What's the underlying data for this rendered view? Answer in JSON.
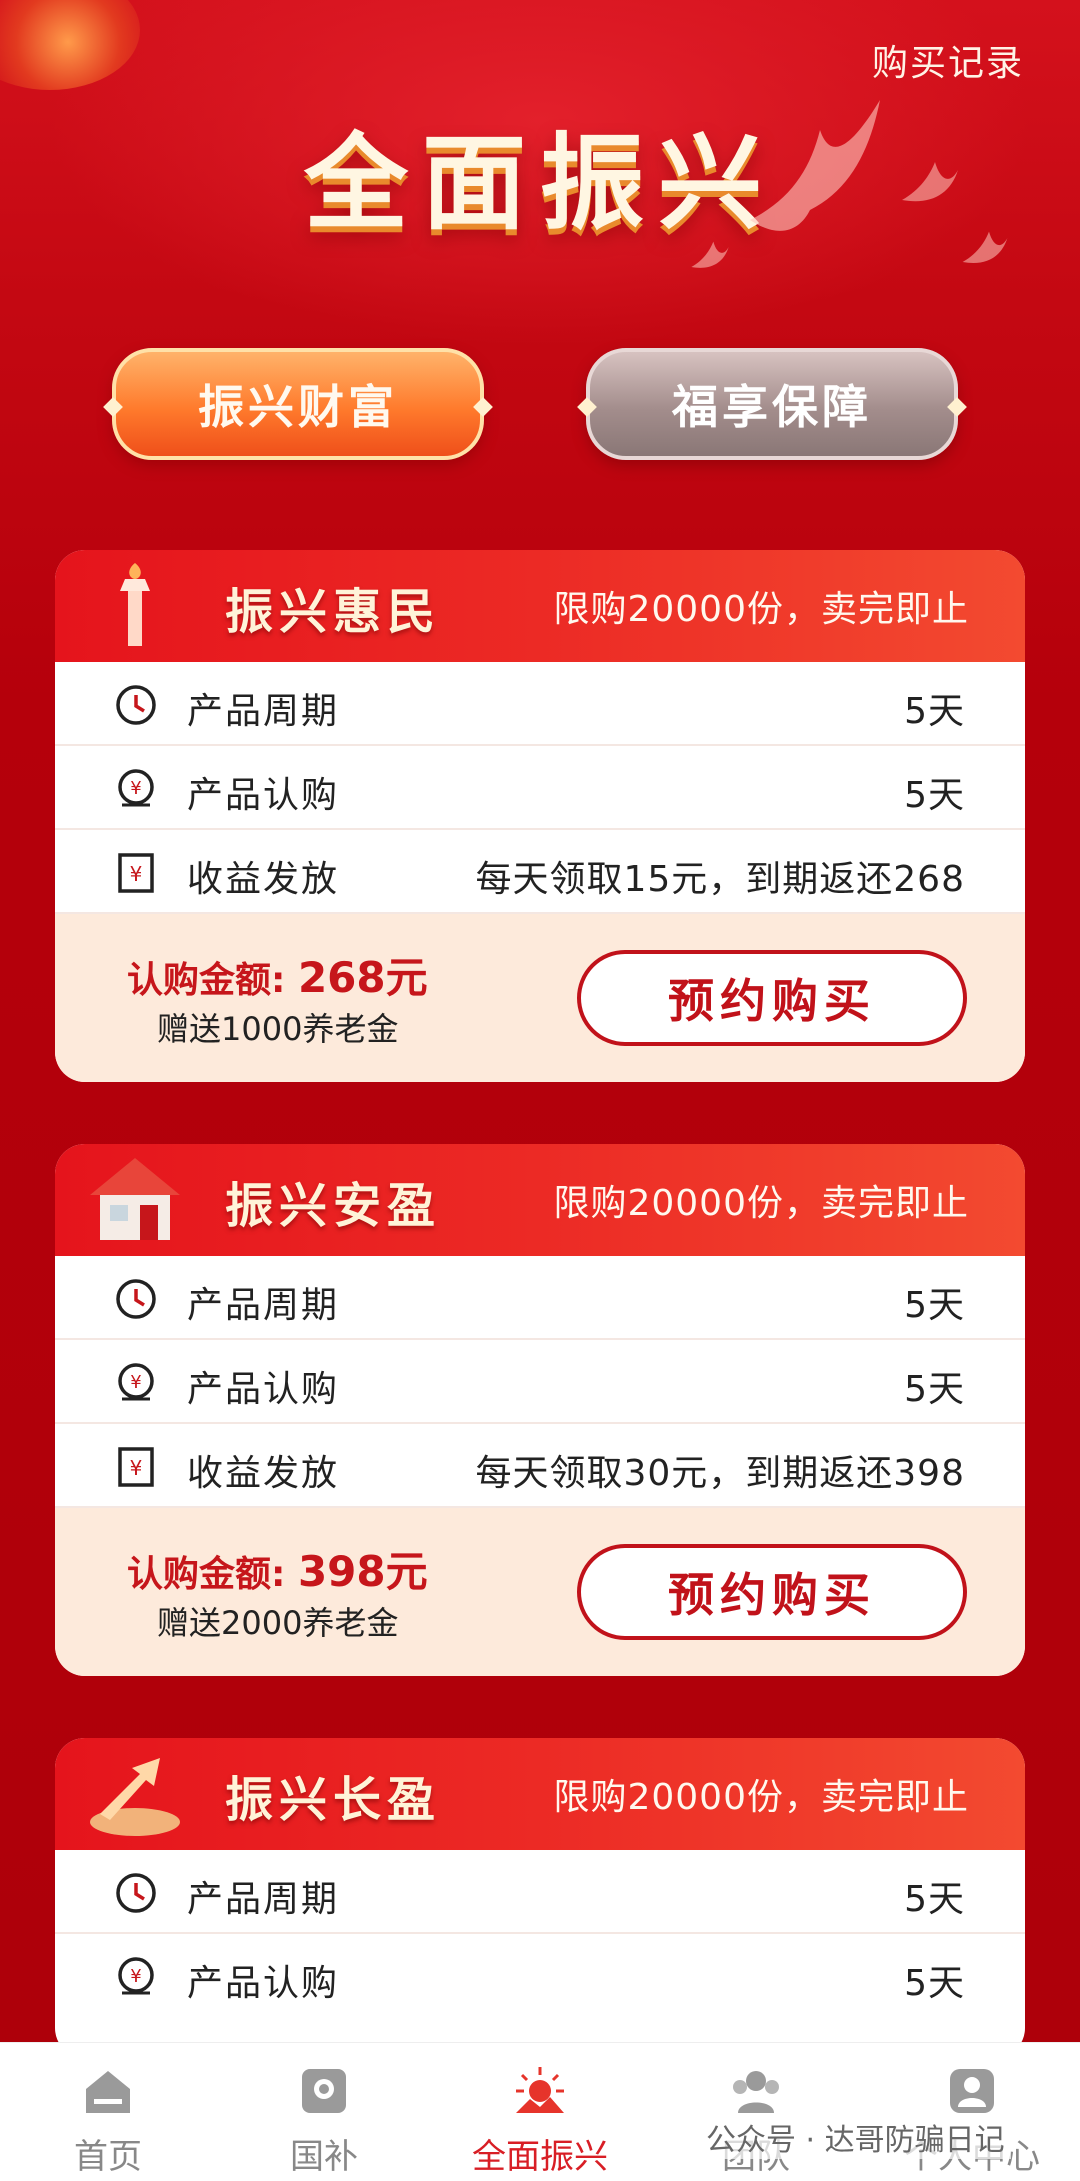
{
  "header": {
    "title": "全面振兴",
    "record_link": "购买记录"
  },
  "tabs": [
    {
      "label": "振兴财富",
      "active": true
    },
    {
      "label": "福享保障",
      "active": false
    }
  ],
  "products": [
    {
      "name": "振兴惠民",
      "limit": "限购20000份，卖完即止",
      "rows": [
        {
          "label": "产品周期",
          "value": "5天",
          "icon": "clock-icon"
        },
        {
          "label": "产品认购",
          "value": "5天",
          "icon": "yuan-coin-icon"
        },
        {
          "label": "收益发放",
          "value": "每天领取15元，到期返还268",
          "icon": "yuan-bill-icon"
        }
      ],
      "amount_label": "认购金额: ",
      "amount": "268元",
      "gift": "赠送1000养老金",
      "button": "预约购买"
    },
    {
      "name": "振兴安盈",
      "limit": "限购20000份，卖完即止",
      "rows": [
        {
          "label": "产品周期",
          "value": "5天",
          "icon": "clock-icon"
        },
        {
          "label": "产品认购",
          "value": "5天",
          "icon": "yuan-coin-icon"
        },
        {
          "label": "收益发放",
          "value": "每天领取30元，到期返还398",
          "icon": "yuan-bill-icon"
        }
      ],
      "amount_label": "认购金额: ",
      "amount": "398元",
      "gift": "赠送2000养老金",
      "button": "预约购买"
    },
    {
      "name": "振兴长盈",
      "limit": "限购20000份，卖完即止",
      "rows": [
        {
          "label": "产品周期",
          "value": "5天",
          "icon": "clock-icon"
        },
        {
          "label": "产品认购",
          "value": "5天",
          "icon": "yuan-coin-icon"
        }
      ]
    }
  ],
  "tabbar": [
    {
      "label": "首页",
      "icon": "home-icon",
      "active": false
    },
    {
      "label": "国补",
      "icon": "badge-icon",
      "active": false
    },
    {
      "label": "全面振兴",
      "icon": "sunrise-icon",
      "active": true
    },
    {
      "label": "团队",
      "icon": "team-icon",
      "active": false
    },
    {
      "label": "个人中心",
      "icon": "profile-icon",
      "active": false
    }
  ],
  "watermark": "公众号 · 达哥防骗日记",
  "colors": {
    "primary_red": "#d81e25",
    "tab_orange": "#ff7a2c",
    "footer_cream": "#fdeadb"
  }
}
